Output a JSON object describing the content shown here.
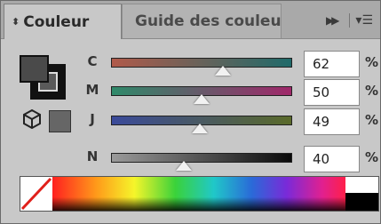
{
  "tabs": [
    {
      "label": "Couleur",
      "active": true
    },
    {
      "label": "Guide des couleur",
      "active": false
    }
  ],
  "icons": {
    "collapse": "chevron-updown-icon",
    "expand": "double-chevron-right-icon",
    "menu": "panel-menu-icon",
    "gamut": "cube-icon"
  },
  "swatches": {
    "fill_color": "#4a4a4a",
    "stroke_color": "#111111"
  },
  "sliders": [
    {
      "channel": "C",
      "value": "62",
      "unit": "%",
      "level": 0.62,
      "gradient": [
        "#b05a4a",
        "#1f6a6a"
      ]
    },
    {
      "channel": "M",
      "value": "50",
      "unit": "%",
      "level": 0.5,
      "gradient": [
        "#2f8a6a",
        "#a0286a"
      ]
    },
    {
      "channel": "J",
      "value": "49",
      "unit": "%",
      "level": 0.49,
      "gradient": [
        "#3a4a9a",
        "#5a6a2a"
      ]
    },
    {
      "channel": "N",
      "value": "40",
      "unit": "%",
      "level": 0.4,
      "gradient": [
        "#9a9a9a",
        "#0a0a0a"
      ]
    }
  ]
}
